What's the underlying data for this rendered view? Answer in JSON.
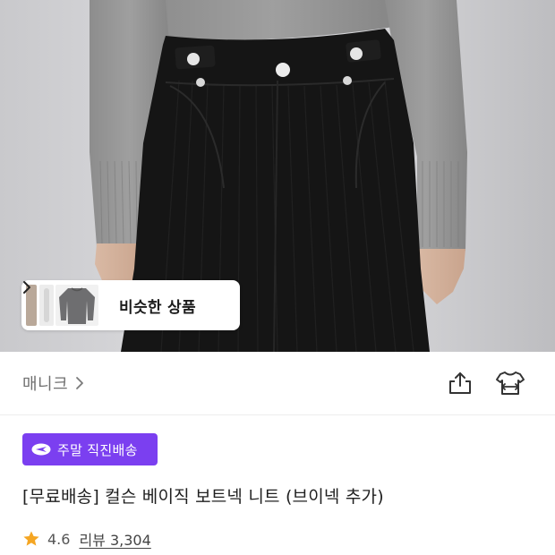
{
  "similar": {
    "label": "비슷한 상품"
  },
  "brand": {
    "name": "매니크"
  },
  "badge": {
    "text": "주말 직진배송",
    "color": "#7b3ff0"
  },
  "product": {
    "title": "[무료배송] 컬슨 베이직 보트넥 니트 (브이넥 추가)"
  },
  "rating": {
    "value": "4.6",
    "review_label": "리뷰 3,304",
    "star_color": "#f5a623"
  },
  "icons": {
    "share": "share-icon",
    "fit": "clothing-size-icon",
    "badge": "delivery-bolt-icon"
  }
}
